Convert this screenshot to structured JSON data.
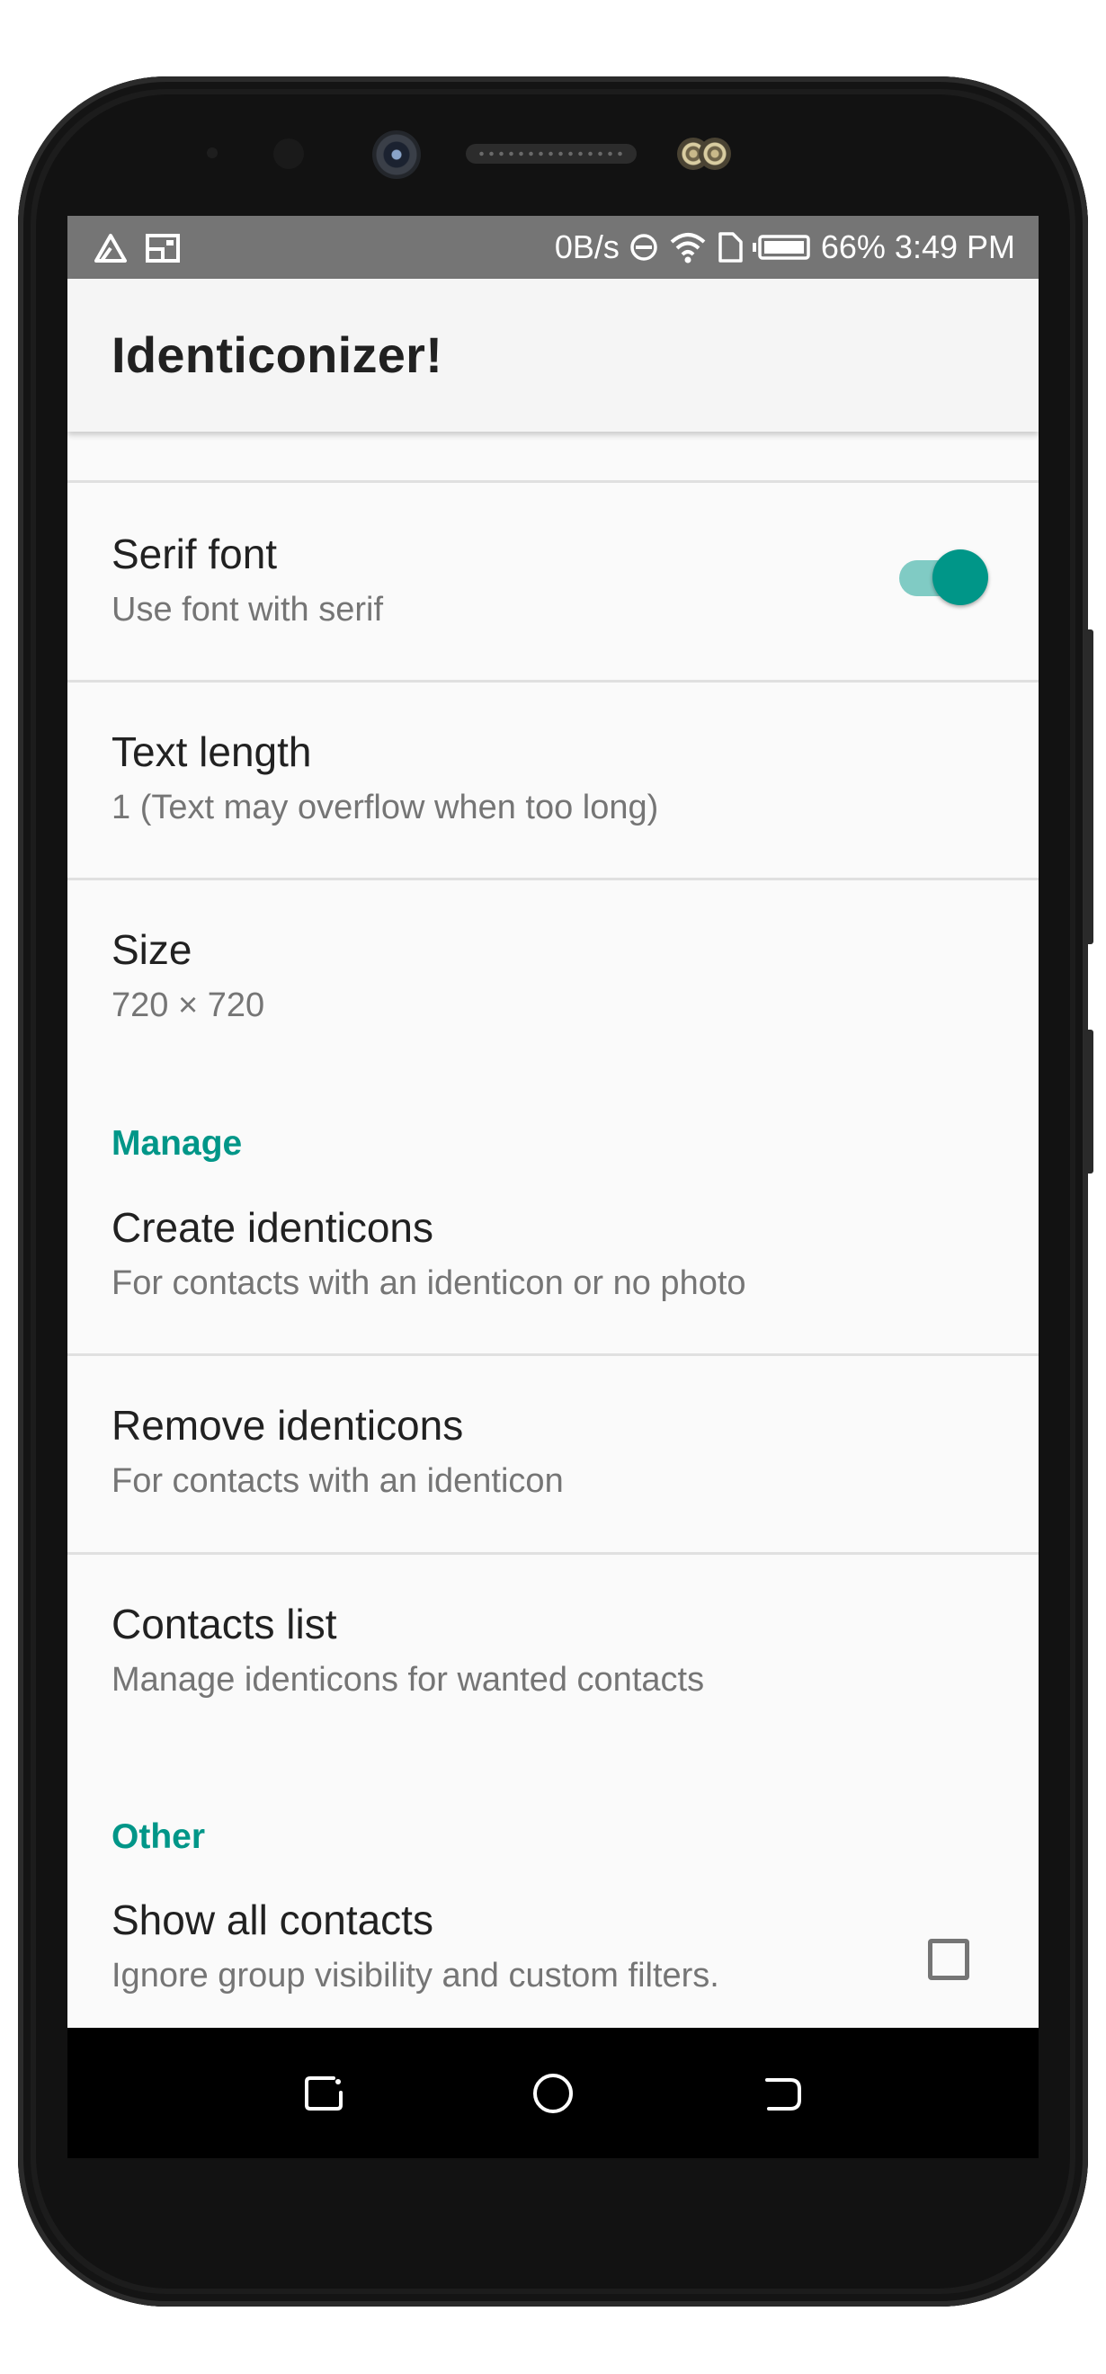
{
  "status_bar": {
    "left_icons": [
      "warning-triangle-icon",
      "cast-screen-icon"
    ],
    "net_speed": "0B/s",
    "battery_percent": "66%",
    "time": "3:49 PM"
  },
  "app": {
    "title": "Identiconizer!"
  },
  "preferences": {
    "serif_font": {
      "title": "Serif font",
      "summary": "Use font with serif",
      "enabled": true
    },
    "text_length": {
      "title": "Text length",
      "summary": "1 (Text may overflow when too long)"
    },
    "size": {
      "title": "Size",
      "summary": "720 × 720"
    }
  },
  "manage": {
    "header": "Manage",
    "items": [
      {
        "title": "Create identicons",
        "summary": "For contacts with an identicon or no photo"
      },
      {
        "title": "Remove identicons",
        "summary": "For contacts with an identicon"
      },
      {
        "title": "Contacts list",
        "summary": "Manage identicons for wanted contacts"
      }
    ]
  },
  "other": {
    "header": "Other",
    "show_all_contacts": {
      "title": "Show all contacts",
      "summary": "Ignore group visibility and custom filters.",
      "checked": false
    }
  },
  "nav_bar": {
    "buttons": [
      "recent-apps-icon",
      "home-icon",
      "back-icon"
    ]
  },
  "colors": {
    "accent": "#009688",
    "accent_light": "#80cbc4",
    "status_bar": "#757575",
    "app_bar": "#f5f5f5",
    "background": "#fafafa"
  }
}
